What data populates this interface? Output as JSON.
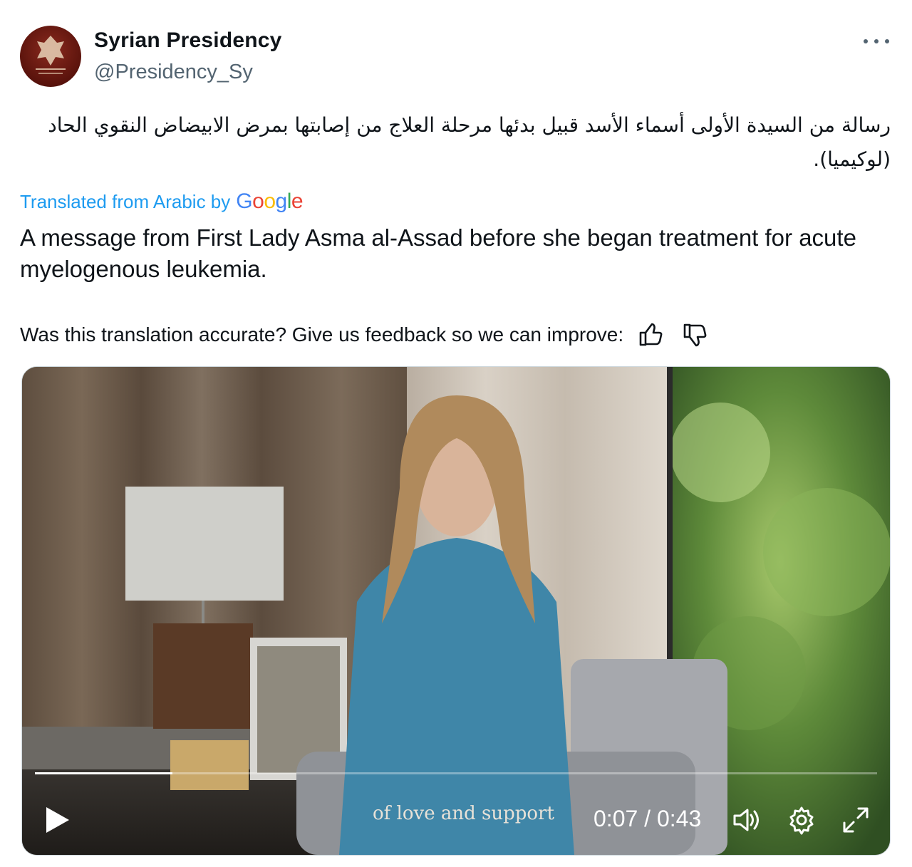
{
  "author": {
    "display_name": "Syrian Presidency",
    "handle": "@Presidency_Sy",
    "avatar_caption": "PRESIDENCY OF THE SYRIAN ARAB REPUBLIC"
  },
  "tweet": {
    "original_text": "رسالة من السيدة الأولى أسماء الأسد قبيل بدئها مرحلة العلاج من إصابتها بمرض الابيضاض النقوي الحاد (لوكيميا).",
    "translated_label": "Translated from Arabic by",
    "translator": "Google",
    "translation": "A message from First Lady Asma al-Assad before she began treatment for acute myelogenous leukemia.",
    "feedback_prompt": "Was this translation accurate? Give us feedback so we can improve:"
  },
  "video": {
    "caption": "of love and support",
    "current_time": "0:07",
    "duration": "0:43",
    "time_separator": " / ",
    "progress_fraction": 0.163
  },
  "icons": {
    "more": "more-icon",
    "thumbs_up": "thumbs-up-icon",
    "thumbs_down": "thumbs-down-icon",
    "play": "play-icon",
    "volume": "volume-icon",
    "settings": "settings-icon",
    "fullscreen": "fullscreen-icon"
  },
  "colors": {
    "link": "#1d9bf0",
    "secondary_text": "#536471"
  }
}
